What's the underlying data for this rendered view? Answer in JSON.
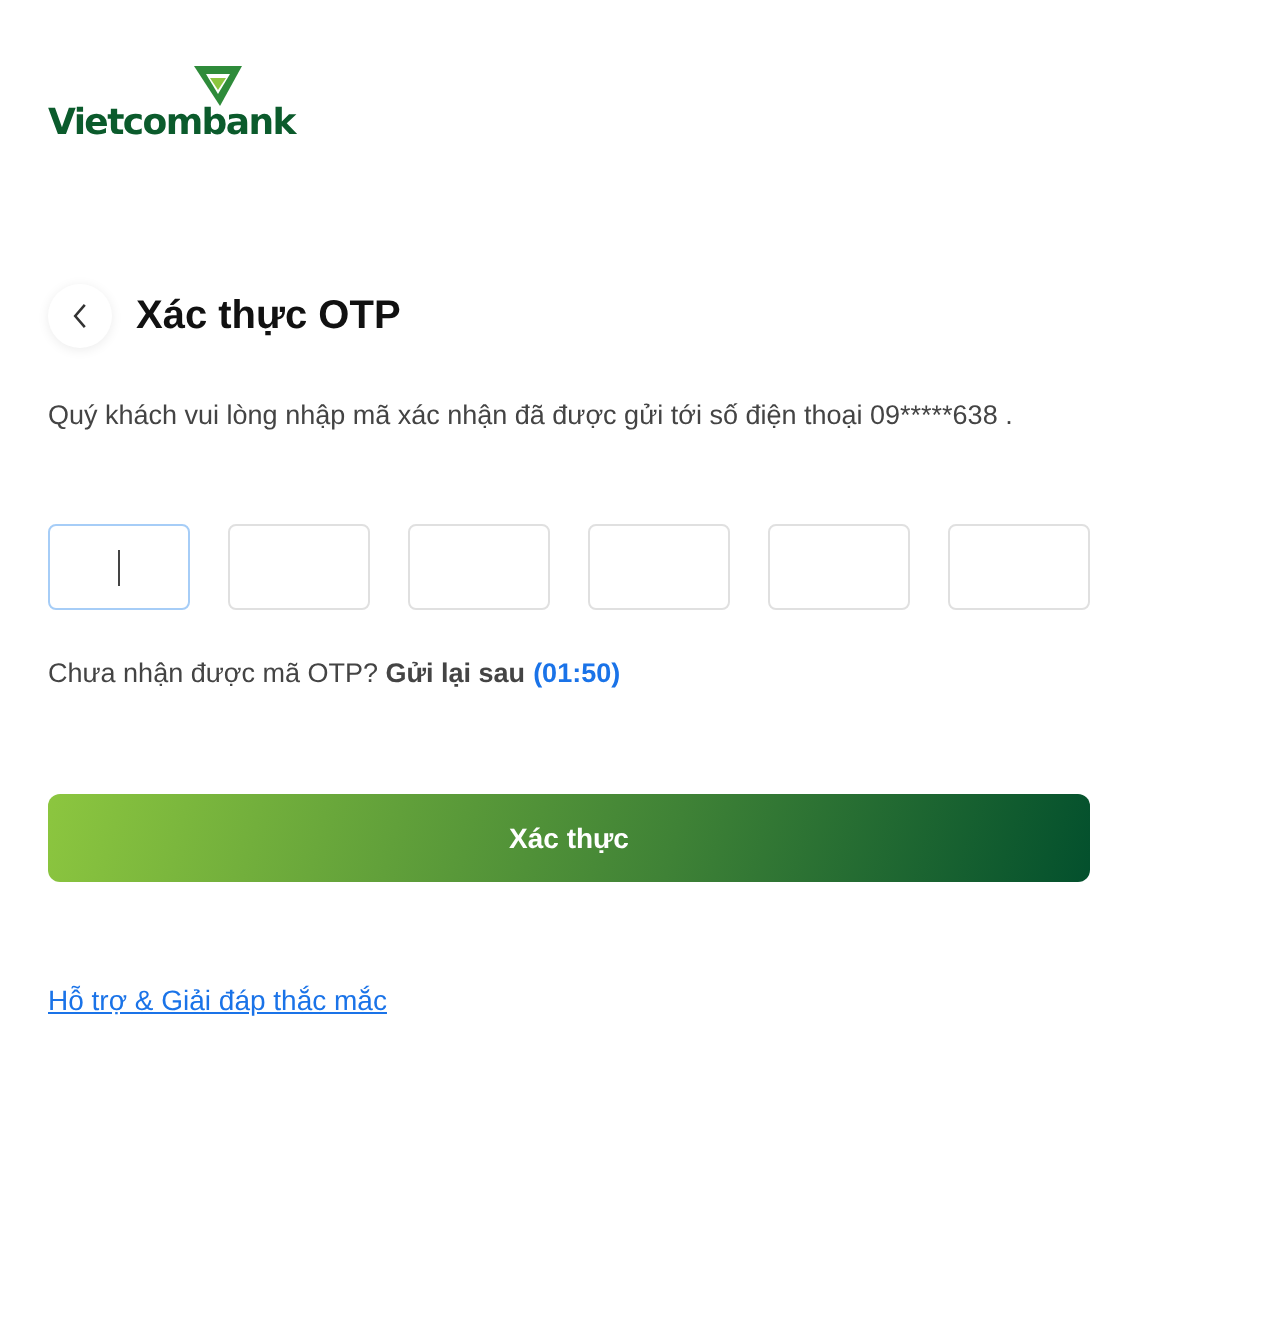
{
  "logo": "Vietcombank",
  "title": "Xác thực OTP",
  "description": "Quý khách vui lòng nhập mã xác nhận đã được gửi tới số điện thoại 09*****638 .",
  "otp_fields": [
    {
      "selected": true
    },
    {
      "selected": false
    },
    {
      "selected": false
    },
    {
      "selected": false
    },
    {
      "selected": false
    },
    {
      "selected": false
    }
  ],
  "resend": {
    "text": "Chưa nhận được mã OTP? **Gửi lại sau**",
    "timer": "(01:50)"
  },
  "submit_button": "Xác thực",
  "help_link": "Hỗ trợ & Giải đáp thắc mắc"
}
